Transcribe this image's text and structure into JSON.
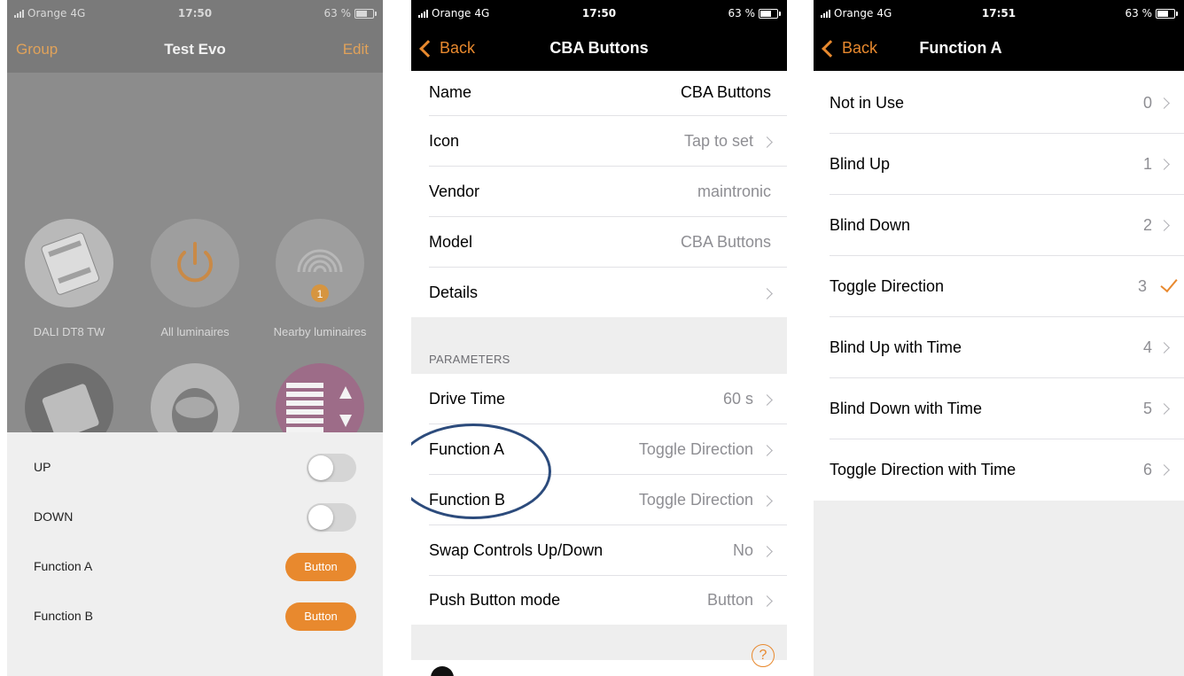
{
  "screen1": {
    "status": {
      "carrier": "Orange",
      "network": "4G",
      "time": "17:50",
      "battery": "63 %"
    },
    "nav": {
      "left": "Group",
      "title": "Test Evo",
      "right": "Edit"
    },
    "tiles": [
      {
        "label": "DALI DT8 TW"
      },
      {
        "label": "All luminaires"
      },
      {
        "label": "Nearby luminaires",
        "badge": "1"
      }
    ],
    "sheet": {
      "rows": [
        {
          "label": "UP",
          "control": "toggle",
          "on": false
        },
        {
          "label": "DOWN",
          "control": "toggle",
          "on": false
        },
        {
          "label": "Function A",
          "control": "button",
          "button_label": "Button"
        },
        {
          "label": "Function B",
          "control": "button",
          "button_label": "Button"
        }
      ]
    }
  },
  "screen2": {
    "status": {
      "carrier": "Orange",
      "network": "4G",
      "time": "17:50",
      "battery": "63 %"
    },
    "nav": {
      "back": "Back",
      "title": "CBA Buttons"
    },
    "info_rows": [
      {
        "key": "Name",
        "value": "CBA Buttons"
      },
      {
        "key": "Icon",
        "value": "Tap to set"
      },
      {
        "key": "Vendor",
        "value": "maintronic"
      },
      {
        "key": "Model",
        "value": "CBA Buttons"
      },
      {
        "key": "Details",
        "value": ""
      }
    ],
    "section_header": "PARAMETERS",
    "param_rows": [
      {
        "key": "Drive Time",
        "value": "60 s"
      },
      {
        "key": "Function A",
        "value": "Toggle Direction"
      },
      {
        "key": "Function B",
        "value": "Toggle Direction"
      },
      {
        "key": "Swap Controls Up/Down",
        "value": "No"
      },
      {
        "key": "Push Button mode",
        "value": "Button"
      }
    ],
    "help_glyph": "?",
    "accent": "#e8892e",
    "highlight_color": "#2c4b7c"
  },
  "screen3": {
    "status": {
      "carrier": "Orange",
      "network": "4G",
      "time": "17:51",
      "battery": "63 %"
    },
    "nav": {
      "back": "Back",
      "title": "Function A"
    },
    "options": [
      {
        "label": "Not in Use",
        "value": "0",
        "selected": false
      },
      {
        "label": "Blind Up",
        "value": "1",
        "selected": false
      },
      {
        "label": "Blind Down",
        "value": "2",
        "selected": false
      },
      {
        "label": "Toggle Direction",
        "value": "3",
        "selected": true
      },
      {
        "label": "Blind Up with Time",
        "value": "4",
        "selected": false
      },
      {
        "label": "Blind Down with Time",
        "value": "5",
        "selected": false
      },
      {
        "label": "Toggle Direction with Time",
        "value": "6",
        "selected": false
      }
    ]
  }
}
